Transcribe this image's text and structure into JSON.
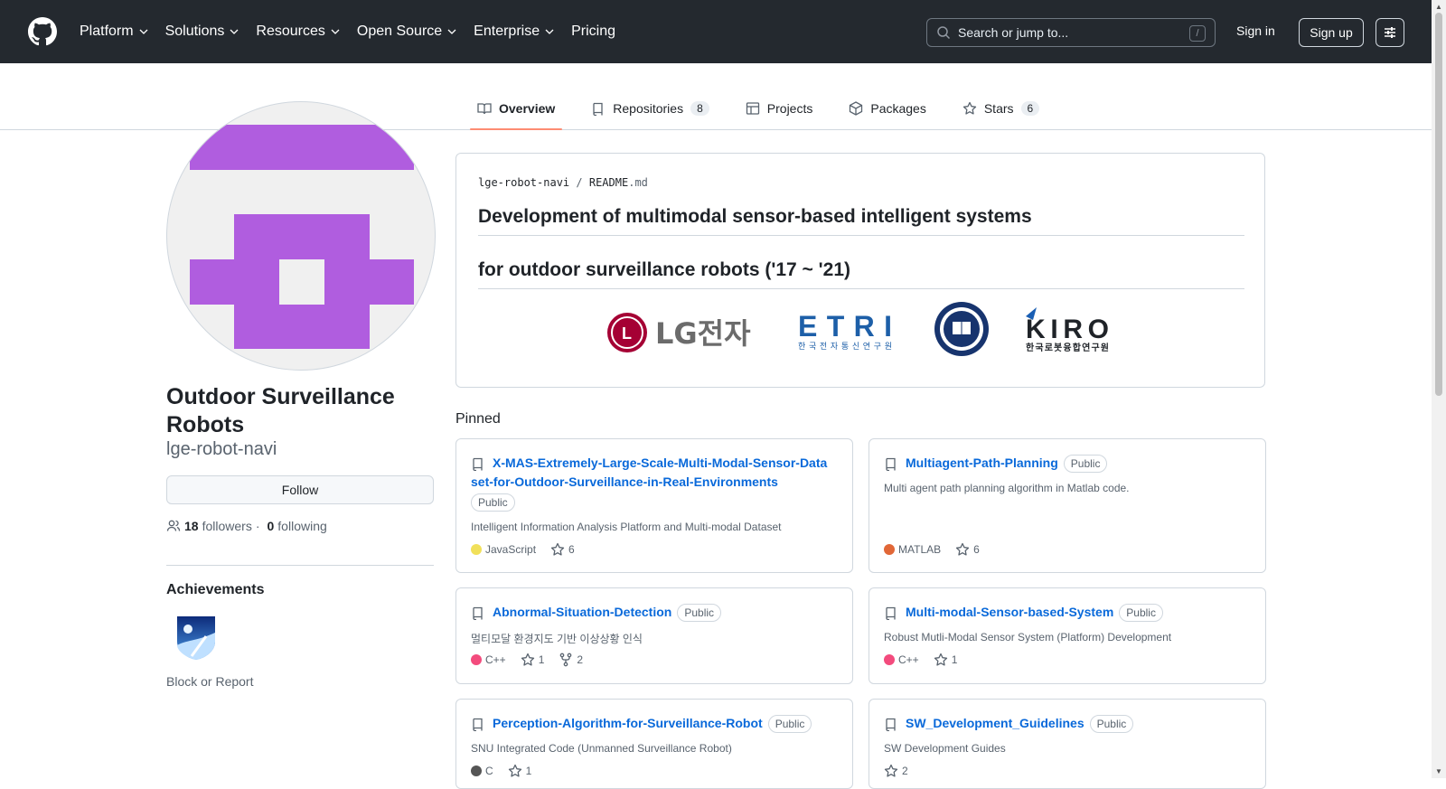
{
  "header": {
    "nav": [
      "Platform",
      "Solutions",
      "Resources",
      "Open Source",
      "Enterprise",
      "Pricing"
    ],
    "nav_has_chevron": [
      true,
      true,
      true,
      true,
      true,
      false
    ],
    "search_placeholder": "Search or jump to...",
    "search_shortcut": "/",
    "signin": "Sign in",
    "signup": "Sign up"
  },
  "tabs": [
    {
      "label": "Overview",
      "count": null,
      "icon": "book-icon",
      "active": true
    },
    {
      "label": "Repositories",
      "count": "8",
      "icon": "repo-icon",
      "active": false
    },
    {
      "label": "Projects",
      "count": null,
      "icon": "table-icon",
      "active": false
    },
    {
      "label": "Packages",
      "count": null,
      "icon": "package-icon",
      "active": false
    },
    {
      "label": "Stars",
      "count": "6",
      "icon": "star-icon",
      "active": false
    }
  ],
  "profile": {
    "name": "Outdoor Surveillance Robots",
    "login": "lge-robot-navi",
    "follow": "Follow",
    "followers_count": "18",
    "followers_label": "followers",
    "separator": "·",
    "following_count": "0",
    "following_label": "following",
    "achievements_title": "Achievements",
    "block": "Block or Report",
    "avatar_color": "#b05ddf"
  },
  "readme": {
    "path_repo": "lge-robot-navi",
    "path_sep": "/",
    "path_file": "README",
    "path_ext": ".md",
    "heading1": "Development of multimodal sensor-based intelligent systems",
    "heading2": "for outdoor surveillance robots ('17 ~ '21)",
    "logos": {
      "lg": "LG전자",
      "etri": "ETRI",
      "etri_sub": "한국전자통신연구원",
      "kiro": "KIRO",
      "kiro_sub": "한국로봇융합연구원"
    }
  },
  "pinned": {
    "title": "Pinned",
    "repos": [
      {
        "name": "X-MAS-Extremely-Large-Scale-Multi-Modal-Sensor-Dataset-for-Outdoor-Surveillance-in-Real-Environments",
        "visibility": "Public",
        "description": "Intelligent Information Analysis Platform and Multi-modal Dataset",
        "language": "JavaScript",
        "lang_color": "#f1e05a",
        "stars": "6",
        "forks": null
      },
      {
        "name": "Multiagent-Path-Planning",
        "visibility": "Public",
        "description": "Multi agent path planning algorithm in Matlab code.",
        "language": "MATLAB",
        "lang_color": "#e16737",
        "stars": "6",
        "forks": null
      },
      {
        "name": "Abnormal-Situation-Detection",
        "visibility": "Public",
        "description": "멀티모달 환경지도 기반 이상상황 인식",
        "language": "C++",
        "lang_color": "#f34b7d",
        "stars": "1",
        "forks": "2"
      },
      {
        "name": "Multi-modal-Sensor-based-System",
        "visibility": "Public",
        "description": "Robust Mutli-Modal Sensor System (Platform) Development",
        "language": "C++",
        "lang_color": "#f34b7d",
        "stars": "1",
        "forks": null
      },
      {
        "name": "Perception-Algorithm-for-Surveillance-Robot",
        "visibility": "Public",
        "description": "SNU Integrated Code (Unmanned Surveillance Robot)",
        "language": "C",
        "lang_color": "#555555",
        "stars": "1",
        "forks": null
      },
      {
        "name": "SW_Development_Guidelines",
        "visibility": "Public",
        "description": "SW Development Guides",
        "language": null,
        "lang_color": null,
        "stars": "2",
        "forks": null
      }
    ]
  }
}
